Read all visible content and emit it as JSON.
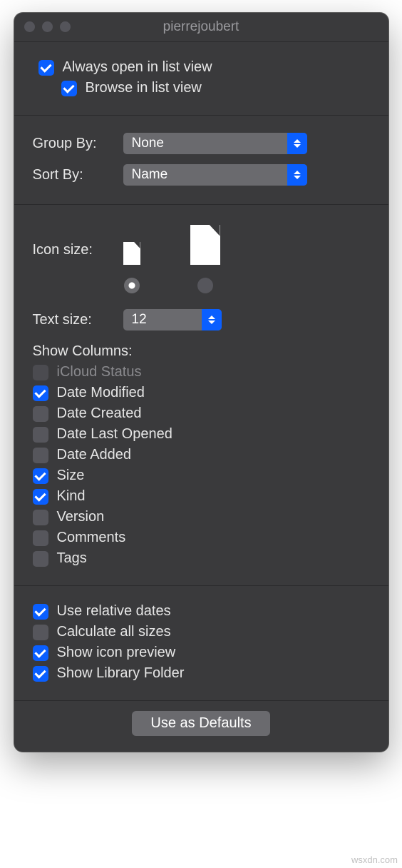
{
  "window": {
    "title": "pierrejoubert"
  },
  "top": {
    "always_open": {
      "label": "Always open in list view",
      "checked": true
    },
    "browse": {
      "label": "Browse in list view",
      "checked": true
    }
  },
  "group_sort": {
    "group_label": "Group By:",
    "group_value": "None",
    "sort_label": "Sort By:",
    "sort_value": "Name"
  },
  "icon_text": {
    "icon_label": "Icon size:",
    "icon_selected": "small",
    "text_label": "Text size:",
    "text_value": "12"
  },
  "show_columns": {
    "heading": "Show Columns:",
    "items": [
      {
        "label": "iCloud Status",
        "checked": false,
        "enabled": false
      },
      {
        "label": "Date Modified",
        "checked": true,
        "enabled": true
      },
      {
        "label": "Date Created",
        "checked": false,
        "enabled": true
      },
      {
        "label": "Date Last Opened",
        "checked": false,
        "enabled": true
      },
      {
        "label": "Date Added",
        "checked": false,
        "enabled": true
      },
      {
        "label": "Size",
        "checked": true,
        "enabled": true
      },
      {
        "label": "Kind",
        "checked": true,
        "enabled": true
      },
      {
        "label": "Version",
        "checked": false,
        "enabled": true
      },
      {
        "label": "Comments",
        "checked": false,
        "enabled": true
      },
      {
        "label": "Tags",
        "checked": false,
        "enabled": true
      }
    ]
  },
  "bottom_options": [
    {
      "label": "Use relative dates",
      "checked": true
    },
    {
      "label": "Calculate all sizes",
      "checked": false
    },
    {
      "label": "Show icon preview",
      "checked": true
    },
    {
      "label": "Show Library Folder",
      "checked": true
    }
  ],
  "defaults_button": "Use as Defaults",
  "watermark": "wsxdn.com"
}
